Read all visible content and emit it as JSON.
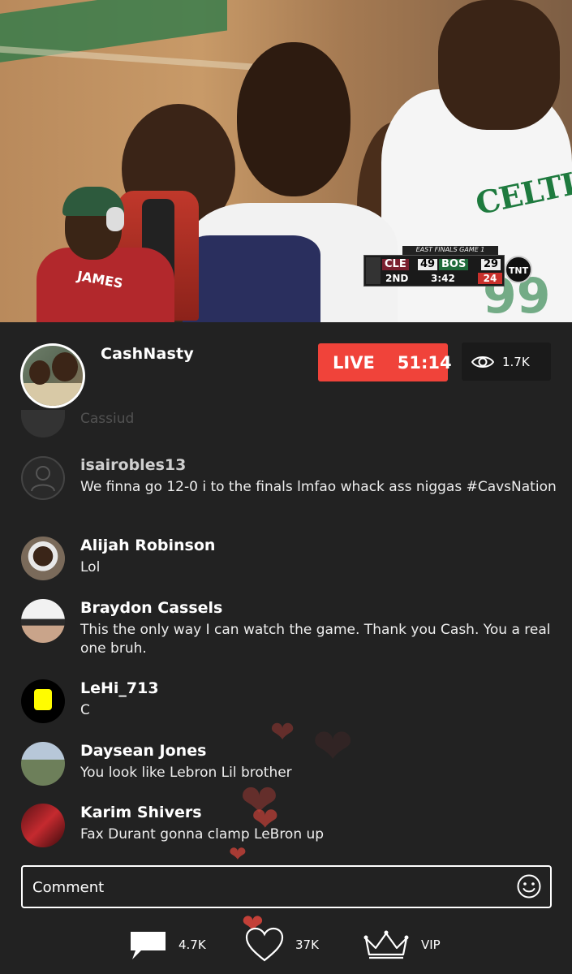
{
  "stream": {
    "host_name": "CashNasty",
    "live_label": "LIVE",
    "elapsed": "51:14",
    "viewers": "1.7K"
  },
  "video": {
    "jersey_text": "CELTICS",
    "jersey_number": "99",
    "streamer_jersey": "JAMES",
    "scorebug": {
      "series": "EAST FINALS GAME 1",
      "team1": "CLE",
      "score1": "49",
      "team2": "BOS",
      "score2": "29",
      "quarter": "2ND",
      "clock": "3:42",
      "shot_clock": "24",
      "network": "TNT"
    }
  },
  "comments": {
    "faded": {
      "user": "Cassiud"
    },
    "items": [
      {
        "user": "isairobles13",
        "text": "We finna go 12-0 i to the finals lmfao whack ass niggas #CavsNation",
        "avatar": "default-avatar"
      },
      {
        "user": "Alijah Robinson",
        "text": "Lol",
        "avatar": "photo"
      },
      {
        "user": "Braydon Cassels",
        "text": "This the only way I can watch the game. Thank you Cash. You a real one bruh.",
        "avatar": "photo"
      },
      {
        "user": "LeHi_713",
        "text": "C",
        "avatar": "snapcode"
      },
      {
        "user": "Daysean Jones",
        "text": "You look like Lebron Lil brother",
        "avatar": "photo"
      },
      {
        "user": "Karim Shivers",
        "text": "Fax Durant gonna clamp LeBron up",
        "avatar": "photo"
      }
    ]
  },
  "input": {
    "placeholder": "Comment",
    "emoji_icon": "smiley-icon"
  },
  "bottom_bar": {
    "comments_count": "4.7K",
    "likes_count": "37K",
    "vip_label": "VIP"
  },
  "colors": {
    "live": "#f0433a",
    "background": "#222222",
    "heart": "#e0463c"
  }
}
